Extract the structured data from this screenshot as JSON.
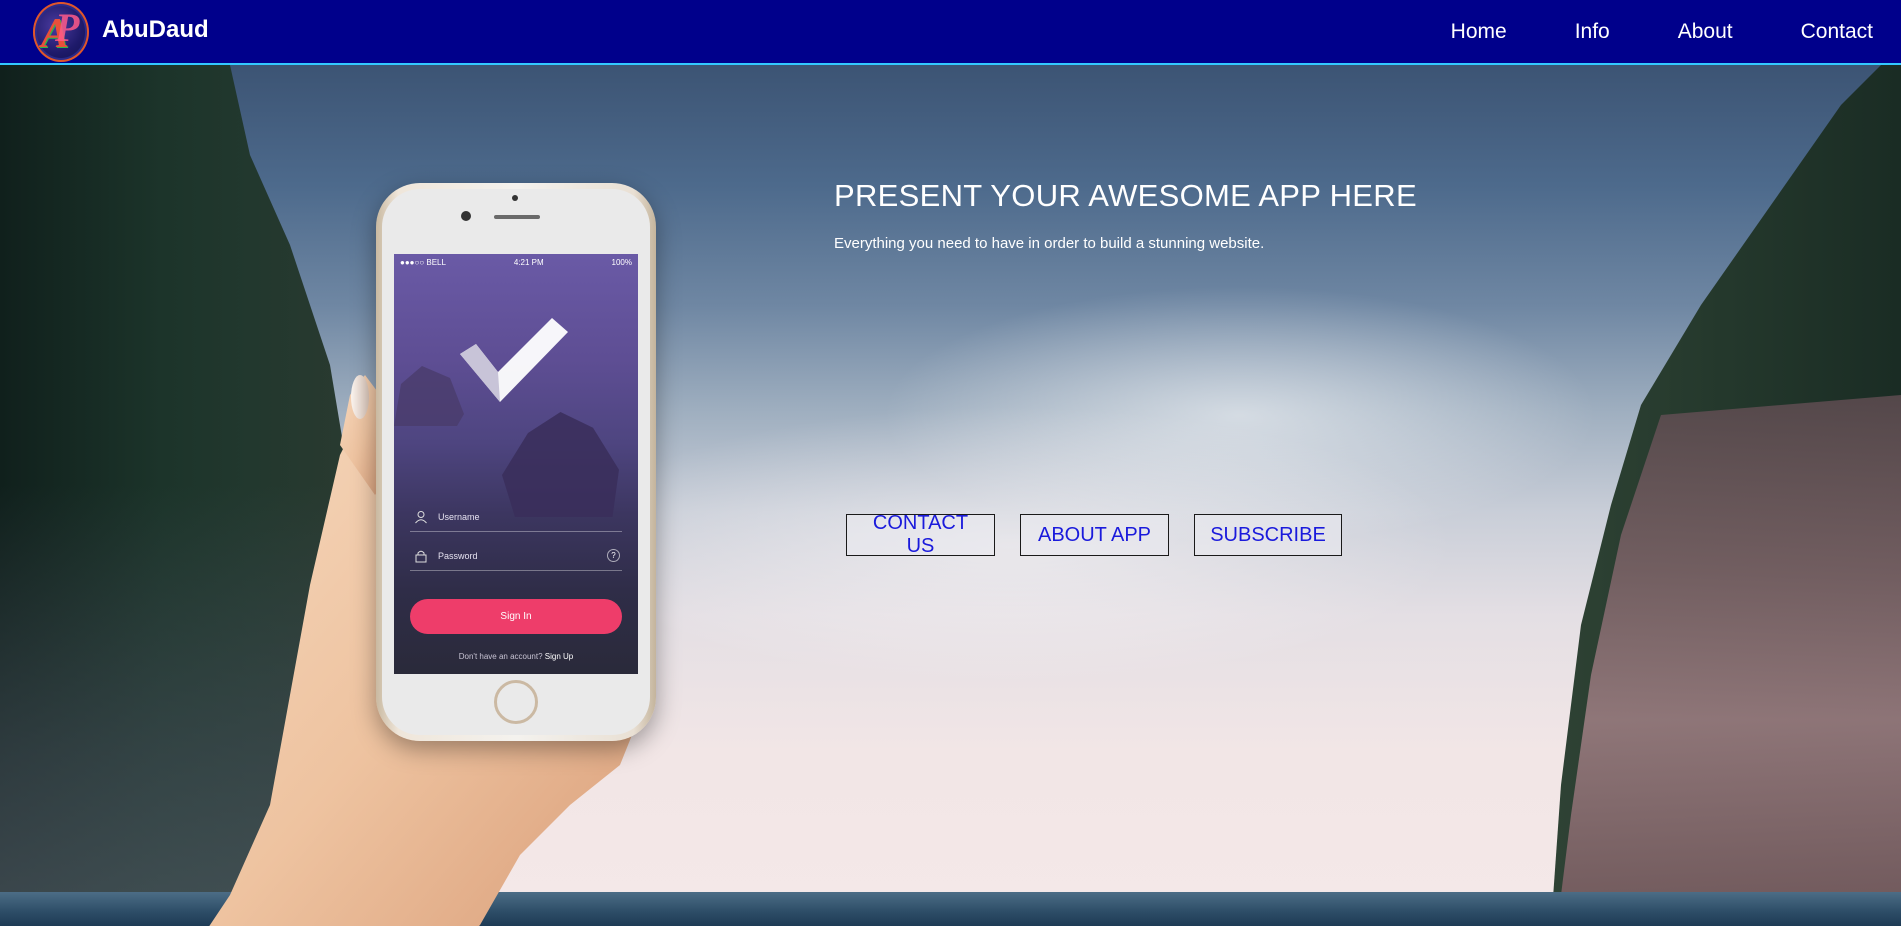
{
  "header": {
    "brand": "AbuDaud",
    "logo_letters": "AP",
    "nav": [
      {
        "label": "Home"
      },
      {
        "label": "Info"
      },
      {
        "label": "About"
      },
      {
        "label": "Contact"
      }
    ],
    "background_color": "#00008b",
    "border_color": "#33c8ff"
  },
  "hero": {
    "title": "PRESENT YOUR AWESOME APP HERE",
    "subtitle": "Everything you need to have in order to build a stunning website.",
    "buttons": [
      {
        "label": "CONTACT US"
      },
      {
        "label": "ABOUT APP"
      },
      {
        "label": "SUBSCRIBE"
      }
    ],
    "button_text_color": "#1a1adc"
  },
  "phone_screen": {
    "status": {
      "carrier": "●●●○○ BELL",
      "time": "4:21 PM",
      "battery": "100%"
    },
    "username_placeholder": "Username",
    "password_placeholder": "Password",
    "help_icon": "?",
    "signin_label": "Sign In",
    "signup_prompt": "Don't have an account?",
    "signup_link": "Sign Up",
    "accent_color": "#ee3d6a"
  }
}
